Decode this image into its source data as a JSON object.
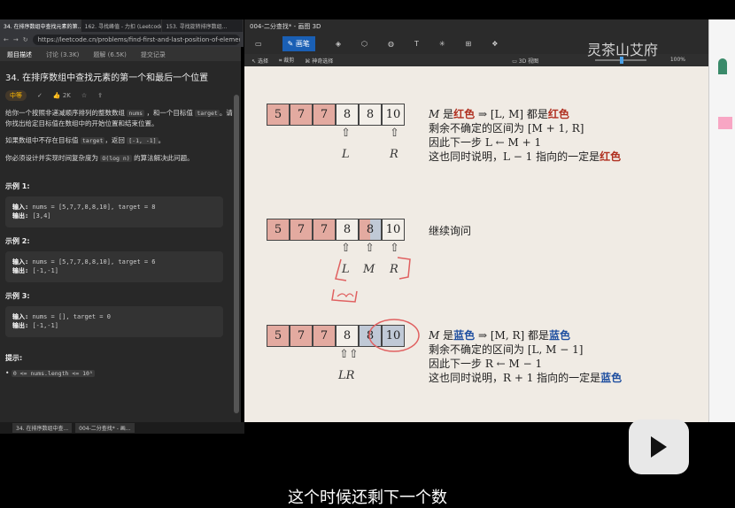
{
  "browser": {
    "tabs": [
      "34. 在排序数组中查找元素的第...",
      "162. 寻找峰值 - 力扣 (Leetcode...)",
      "153. 寻找旋转排序数组..."
    ],
    "url": "https://leetcode.cn/problems/find-first-and-last-position-of-element-in-sorted-..."
  },
  "leetcode": {
    "tabs": [
      "题目描述",
      "讨论 (3.3K)",
      "题解 (6.5K)",
      "提交记录"
    ],
    "title": "34. 在排序数组中查找元素的第一个和最后一个位置",
    "difficulty": "中等",
    "likes": "2K",
    "desc1a": "给你一个按照非递减顺序排列的整数数组",
    "desc1b": "nums",
    "desc1c": "，和一个目标值",
    "desc1d": "target",
    "desc1e": "。请你找出给定目标值在数组中的开始位置和结束位置。",
    "desc2a": "如果数组中不存在目标值",
    "desc2b": "target",
    "desc2c": "，返回",
    "desc2d": "[-1, -1]",
    "desc2e": "。",
    "desc3a": "你必须设计并实现时间复杂度为",
    "desc3b": "O(log n)",
    "desc3c": "的算法解决此问题。",
    "examples": [
      {
        "title": "示例 1:",
        "input_label": "输入:",
        "input": "nums = [5,7,7,8,8,10], target = 8",
        "output_label": "输出:",
        "output": "[3,4]"
      },
      {
        "title": "示例 2:",
        "input_label": "输入:",
        "input": "nums = [5,7,7,8,8,10], target = 6",
        "output_label": "输出:",
        "output": "[-1,-1]"
      },
      {
        "title": "示例 3:",
        "input_label": "输入:",
        "input": "nums = [], target = 0",
        "output_label": "输出:",
        "output": "[-1,-1]"
      }
    ],
    "hint_title": "提示:",
    "hint": "0 <= nums.length <= 10⁵"
  },
  "taskbar": {
    "items": [
      "34. 在排序数组中查...",
      "004-二分查找* - 画..."
    ]
  },
  "paint": {
    "title": "004-二分查找* - 画图 3D",
    "tool_label": "画笔",
    "select": "选择",
    "crop": "裁剪",
    "magic": "神奇选择",
    "view3d": "3D 视图",
    "zoom": "100%"
  },
  "canvas": {
    "row1": [
      "5",
      "7",
      "7",
      "8",
      "8",
      "10"
    ],
    "row2": [
      "5",
      "7",
      "7",
      "8",
      "8",
      "10"
    ],
    "row3": [
      "5",
      "7",
      "7",
      "8",
      "8",
      "10"
    ],
    "r1_L": "L",
    "r1_R": "R",
    "r2_L": "L",
    "r2_M": "M",
    "r2_R": "R",
    "r3_LR": "LR",
    "note1": {
      "a1": "M",
      "a2": "是",
      "a3": "红色",
      "a4": "⇒ [L, M] 都是",
      "a5": "红色",
      "b": "剩余不确定的区间为 [M + 1, R]",
      "c": "因此下一步 L ← M + 1",
      "d1": "这也同时说明，L − 1 指向的一定是",
      "d2": "红色"
    },
    "note2": "继续询问",
    "note3": {
      "a1": "M",
      "a2": "是",
      "a3": "蓝色",
      "a4": "⇒ [M, R] 都是",
      "a5": "蓝色",
      "b": "剩余不确定的区间为 [L, M − 1]",
      "c": "因此下一步 R ← M − 1",
      "d1": "这也同时说明，R + 1 指向的一定是",
      "d2": "蓝色"
    }
  },
  "watermark": "灵茶山艾府",
  "subtitle": "这个时候还剩下一个数"
}
